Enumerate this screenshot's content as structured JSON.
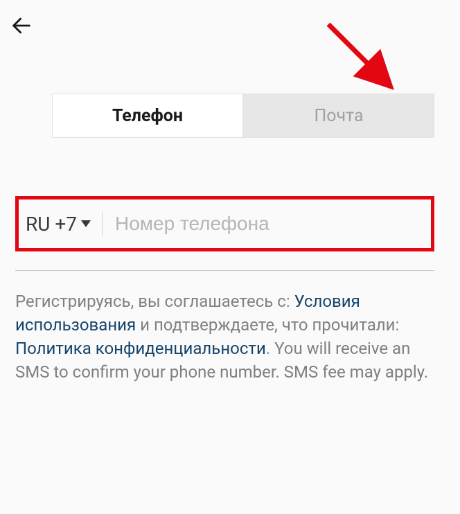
{
  "nav": {
    "back_icon": "back-arrow"
  },
  "tabs": {
    "phone": "Телефон",
    "email": "Почта"
  },
  "phone_field": {
    "country_code": "RU +7",
    "placeholder": "Номер телефона",
    "value": ""
  },
  "consent": {
    "part1": "Регистрируясь, вы соглашаетесь с: ",
    "link_terms": "Условия использования",
    "part2": " и подтверждаете, что прочитали: ",
    "link_privacy": "Политика конфиденциальности",
    "part3": ". You will receive an SMS to confirm your phone number. SMS fee may apply."
  }
}
